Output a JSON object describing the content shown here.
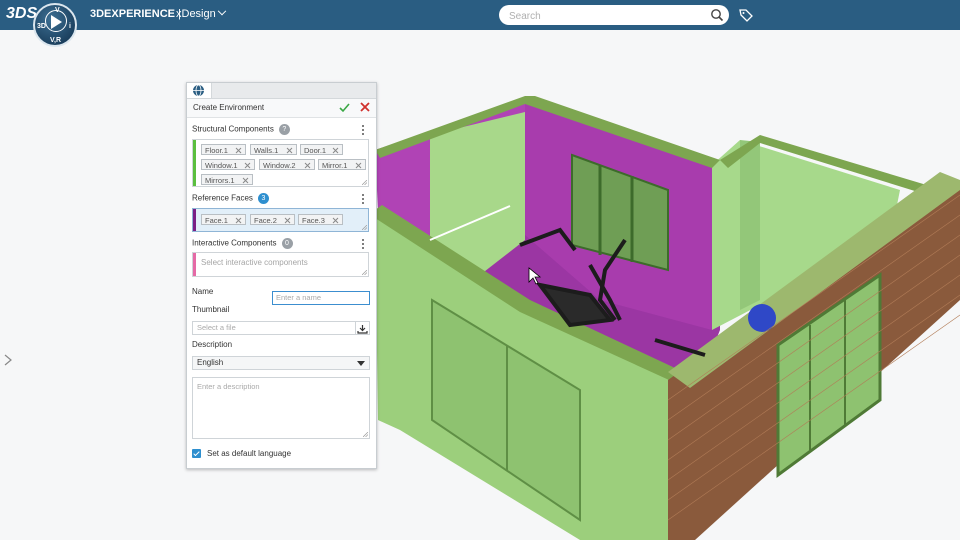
{
  "header": {
    "logo": "3DS",
    "compass": {
      "top": "V",
      "left": "3D",
      "right": "i",
      "bottom": "V,R"
    },
    "brand_bold": "3DEXPERIENCE",
    "brand_sep": " | ",
    "app_name": "xDesign",
    "search_placeholder": "Search"
  },
  "panel": {
    "title": "Create Environment",
    "structural": {
      "label": "Structural Components",
      "chips": [
        "Floor.1",
        "Walls.1",
        "Door.1",
        "Window.1",
        "Window.2",
        "Mirror.1",
        "Mirrors.1"
      ]
    },
    "reference": {
      "label": "Reference Faces",
      "count": "3",
      "chips": [
        "Face.1",
        "Face.2",
        "Face.3"
      ]
    },
    "interactive": {
      "label": "Interactive Components",
      "count": "0",
      "placeholder": "Select interactive components"
    },
    "name": {
      "label": "Name",
      "placeholder": "Enter a name"
    },
    "thumbnail": {
      "label": "Thumbnail",
      "placeholder": "Select a file"
    },
    "description": {
      "label": "Description",
      "language": "English",
      "placeholder": "Enter a description"
    },
    "default_language_label": "Set as default language"
  },
  "colors": {
    "topbar": "#2a5d82",
    "accent": "#2e8fcf",
    "wall_green": "#9ccf7c",
    "wall_purple": "#a23aa8",
    "brick": "#8a5a3c"
  }
}
